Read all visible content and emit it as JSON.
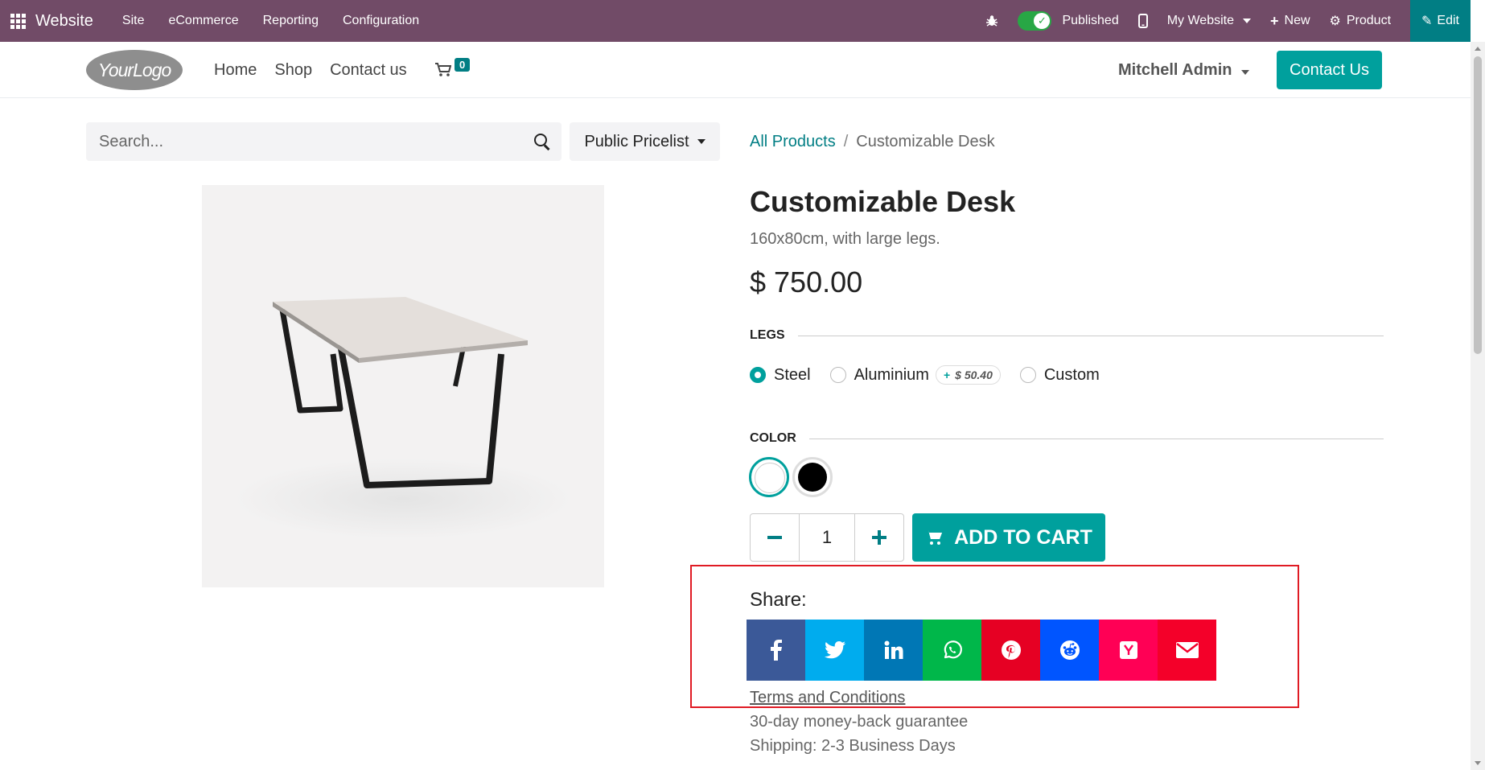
{
  "topbar": {
    "app_name": "Website",
    "menus": [
      "Site",
      "eCommerce",
      "Reporting",
      "Configuration"
    ],
    "published_label": "Published",
    "website_label": "My Website",
    "new_label": "New",
    "product_label": "Product",
    "edit_label": "Edit",
    "bg_color": "#714B67",
    "edit_bg_color": "#017E84"
  },
  "header": {
    "logo_text": "YourLogo",
    "nav": [
      "Home",
      "Shop",
      "Contact us"
    ],
    "cart_count": "0",
    "user_name": "Mitchell Admin",
    "contact_button": "Contact Us"
  },
  "search": {
    "placeholder": "Search...",
    "pricelist": "Public Pricelist"
  },
  "breadcrumb": {
    "parent": "All Products",
    "separator": "/",
    "current": "Customizable Desk"
  },
  "product": {
    "title": "Customizable Desk",
    "description": "160x80cm, with large legs.",
    "price": "$ 750.00",
    "legs_label": "LEGS",
    "legs_options": [
      {
        "label": "Steel",
        "selected": true
      },
      {
        "label": "Aluminium",
        "extra": "$ 50.40",
        "selected": false
      },
      {
        "label": "Custom",
        "selected": false
      }
    ],
    "color_label": "COLOR",
    "colors": [
      {
        "name": "White",
        "hex": "#ffffff",
        "selected": true
      },
      {
        "name": "Black",
        "hex": "#000000",
        "selected": false
      }
    ],
    "quantity": "1",
    "add_to_cart": "ADD TO CART"
  },
  "share": {
    "label": "Share:",
    "networks": [
      {
        "name": "facebook",
        "color": "#3b5998"
      },
      {
        "name": "twitter",
        "color": "#00acee"
      },
      {
        "name": "linkedin",
        "color": "#0077b5"
      },
      {
        "name": "whatsapp",
        "color": "#00B74A"
      },
      {
        "name": "pinterest",
        "color": "#E60023"
      },
      {
        "name": "reddit",
        "color": "#0055FF"
      },
      {
        "name": "hacker-news",
        "color": "#FF0055"
      },
      {
        "name": "email",
        "color": "#F40029"
      }
    ]
  },
  "footer_info": {
    "terms": "Terms and Conditions",
    "guarantee": "30-day money-back guarantee",
    "shipping": "Shipping: 2-3 Business Days"
  },
  "accent_color": "#00A09D",
  "highlight_color": "#e01b24"
}
